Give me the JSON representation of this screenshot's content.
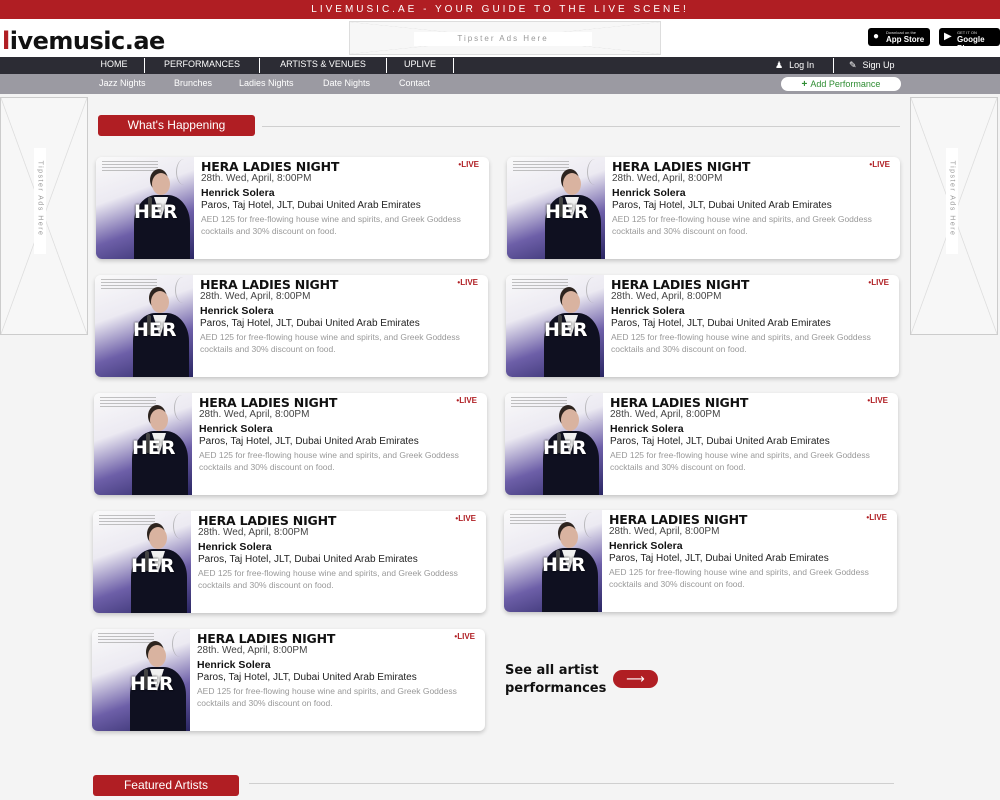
{
  "topbar": {
    "text": "LIVEMUSIC.AE - YOUR GUIDE TO THE LIVE SCENE!"
  },
  "header": {
    "logo_prefix": "l",
    "logo_rest": "ivemusic.ae",
    "ad_label": "Tipster Ads Here",
    "app_store": {
      "small": "Download on the",
      "big": "App Store"
    },
    "google_play": {
      "small": "GET IT ON",
      "big": "Google Play"
    }
  },
  "nav": {
    "items": [
      "HOME",
      "PERFORMANCES",
      "ARTISTS & VENUES",
      "UPLIVE"
    ],
    "login": "Log In",
    "signup": "Sign Up"
  },
  "subnav": {
    "items": [
      "Jazz Nights",
      "Brunches",
      "Ladies Nights",
      "Date Nights",
      "Contact"
    ],
    "add_button": "Add Performance"
  },
  "side_ads": {
    "label": "Tipster Ads Here"
  },
  "sections": {
    "whats_happening": "What's Happening",
    "featured_artists": "Featured Artists"
  },
  "cards": [
    {
      "title": "HERA LADIES NIGHT",
      "live": "LIVE",
      "date": "28th. Wed, April, 8:00PM",
      "artist": "Henrick Solera",
      "venue": "Paros, Taj Hotel, JLT, Dubai United Arab Emirates",
      "description": "AED 125 for free-flowing house wine and spirits, and Greek Goddess cocktails and 30% discount on food.",
      "image_text": "HER"
    },
    {
      "title": "HERA LADIES NIGHT",
      "live": "LIVE",
      "date": "28th. Wed, April, 8:00PM",
      "artist": "Henrick Solera",
      "venue": "Paros, Taj Hotel, JLT, Dubai United Arab Emirates",
      "description": "AED 125 for free-flowing house wine and spirits, and Greek Goddess cocktails and 30% discount on food.",
      "image_text": "HER"
    },
    {
      "title": "HERA LADIES NIGHT",
      "live": "LIVE",
      "date": "28th. Wed, April, 8:00PM",
      "artist": "Henrick Solera",
      "venue": "Paros, Taj Hotel, JLT, Dubai United Arab Emirates",
      "description": "AED 125 for free-flowing house wine and spirits, and Greek Goddess cocktails and 30% discount on food.",
      "image_text": "HER"
    },
    {
      "title": "HERA LADIES NIGHT",
      "live": "LIVE",
      "date": "28th. Wed, April, 8:00PM",
      "artist": "Henrick Solera",
      "venue": "Paros, Taj Hotel, JLT, Dubai United Arab Emirates",
      "description": "AED 125 for free-flowing house wine and spirits, and Greek Goddess cocktails and 30% discount on food.",
      "image_text": "HER"
    },
    {
      "title": "HERA LADIES NIGHT",
      "live": "LIVE",
      "date": "28th. Wed, April, 8:00PM",
      "artist": "Henrick Solera",
      "venue": "Paros, Taj Hotel, JLT, Dubai United Arab Emirates",
      "description": "AED 125 for free-flowing house wine and spirits, and Greek Goddess cocktails and 30% discount on food.",
      "image_text": "HER"
    },
    {
      "title": "HERA LADIES NIGHT",
      "live": "LIVE",
      "date": "28th. Wed, April, 8:00PM",
      "artist": "Henrick Solera",
      "venue": "Paros, Taj Hotel, JLT, Dubai United Arab Emirates",
      "description": "AED 125 for free-flowing house wine and spirits, and Greek Goddess cocktails and 30% discount on food.",
      "image_text": "HER"
    },
    {
      "title": "HERA LADIES NIGHT",
      "live": "LIVE",
      "date": "28th. Wed, April, 8:00PM",
      "artist": "Henrick Solera",
      "venue": "Paros, Taj Hotel, JLT, Dubai United Arab Emirates",
      "description": "AED 125 for free-flowing house wine and spirits, and Greek Goddess cocktails and 30% discount on food.",
      "image_text": "HER"
    },
    {
      "title": "HERA LADIES NIGHT",
      "live": "LIVE",
      "date": "28th. Wed, April, 8:00PM",
      "artist": "Henrick Solera",
      "venue": "Paros, Taj Hotel, JLT, Dubai United Arab Emirates",
      "description": "AED 125 for free-flowing house wine and spirits, and Greek Goddess cocktails and 30% discount on food.",
      "image_text": "HER"
    },
    {
      "title": "HERA LADIES NIGHT",
      "live": "LIVE",
      "date": "28th. Wed, April, 8:00PM",
      "artist": "Henrick Solera",
      "venue": "Paros, Taj Hotel, JLT, Dubai United Arab Emirates",
      "description": "AED 125 for free-flowing house wine and spirits, and Greek Goddess cocktails and 30% discount on food.",
      "image_text": "HER"
    }
  ],
  "see_all": {
    "line1": "See all artist",
    "line2": "performances",
    "arrow": "⟶"
  },
  "colors": {
    "brand_red": "#b01e23",
    "nav_dark": "#2c2c34",
    "subnav_gray": "#9b9aa2",
    "add_green": "#2f8d33"
  },
  "icons": {
    "user": "user-icon",
    "signup": "edit-icon",
    "apple": "apple-icon",
    "play": "play-icon",
    "plus": "plus-icon",
    "arrow": "arrow-right-icon"
  }
}
